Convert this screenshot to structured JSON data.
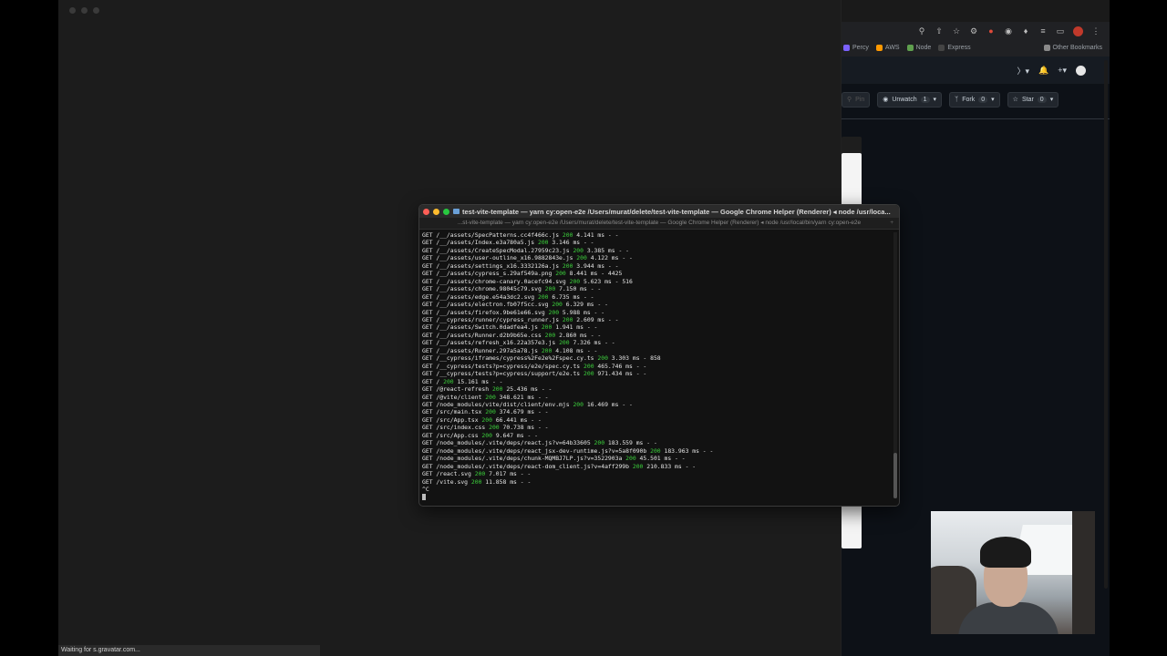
{
  "big_window": {
    "status_text": "Waiting for s.gravatar.com..."
  },
  "browser": {
    "bookmarks": [
      {
        "label": "Percy",
        "color": "#7b61ff"
      },
      {
        "label": "AWS",
        "color": "#ff9900"
      },
      {
        "label": "Node",
        "color": "#5fa04e"
      },
      {
        "label": "Express",
        "color": "#444444"
      }
    ],
    "other_bookmarks": "Other Bookmarks",
    "repo_actions": {
      "pin": "Pin",
      "unwatch": "Unwatch",
      "unwatch_count": "1",
      "fork": "Fork",
      "fork_count": "0",
      "star": "Star",
      "star_count": "0"
    }
  },
  "terminal": {
    "title": "test-vite-template — yarn cy:open-e2e /Users/murat/delete/test-vite-template — Google Chrome Helper (Renderer) ◂ node /usr/loca...",
    "tab_title": "...st-vite-template — yarn cy:open-e2e /Users/murat/delete/test-vite-template — Google Chrome Helper (Renderer) ◂ node /usr/local/bin/yarn cy:open-e2e",
    "lines": [
      {
        "pre": "GET /__/assets/SpecPatterns.cc4f466c.js ",
        "status": "200",
        "post": " 4.141 ms - -"
      },
      {
        "pre": "GET /__/assets/Index.e3a780a5.js ",
        "status": "200",
        "post": " 3.146 ms - -"
      },
      {
        "pre": "GET /__/assets/CreateSpecModal.27959c23.js ",
        "status": "200",
        "post": " 3.385 ms - -"
      },
      {
        "pre": "GET /__/assets/user-outline_x16.9882843e.js ",
        "status": "200",
        "post": " 4.122 ms - -"
      },
      {
        "pre": "GET /__/assets/settings_x16.3332126a.js ",
        "status": "200",
        "post": " 3.944 ms - -"
      },
      {
        "pre": "GET /__/assets/cypress_s.29af549a.png ",
        "status": "200",
        "post": " 8.441 ms - 4425"
      },
      {
        "pre": "GET /__/assets/chrome-canary.0acefc94.svg ",
        "status": "200",
        "post": " 5.623 ms - 516"
      },
      {
        "pre": "GET /__/assets/chrome.98045c79.svg ",
        "status": "200",
        "post": " 7.150 ms - -"
      },
      {
        "pre": "GET /__/assets/edge.e54a3dc2.svg ",
        "status": "200",
        "post": " 6.735 ms - -"
      },
      {
        "pre": "GET /__/assets/electron.fb07f5cc.svg ",
        "status": "200",
        "post": " 6.329 ms - -"
      },
      {
        "pre": "GET /__/assets/firefox.9be61e66.svg ",
        "status": "200",
        "post": " 5.988 ms - -"
      },
      {
        "pre": "GET /__cypress/runner/cypress_runner.js ",
        "status": "200",
        "post": " 2.609 ms - -"
      },
      {
        "pre": "GET /__/assets/Switch.0dadfea4.js ",
        "status": "200",
        "post": " 1.941 ms - -"
      },
      {
        "pre": "GET /__/assets/Runner.d2b9b65e.css ",
        "status": "200",
        "post": " 2.860 ms - -"
      },
      {
        "pre": "GET /__/assets/refresh_x16.22a357e3.js ",
        "status": "200",
        "post": " 7.326 ms - -"
      },
      {
        "pre": "GET /__/assets/Runner.297a5a78.js ",
        "status": "200",
        "post": " 4.108 ms - -"
      },
      {
        "pre": "GET /__cypress/iframes/cypress%2Fe2e%2Fspec.cy.ts ",
        "status": "200",
        "post": " 3.303 ms - 858"
      },
      {
        "pre": "GET /__cypress/tests?p=cypress/e2e/spec.cy.ts ",
        "status": "200",
        "post": " 465.746 ms - -"
      },
      {
        "pre": "GET /__cypress/tests?p=cypress/support/e2e.ts ",
        "status": "200",
        "post": " 971.434 ms - -"
      },
      {
        "pre": "GET / ",
        "status": "200",
        "post": " 15.161 ms - -"
      },
      {
        "pre": "GET /@react-refresh ",
        "status": "200",
        "post": " 25.436 ms - -"
      },
      {
        "pre": "GET /@vite/client ",
        "status": "200",
        "post": " 348.621 ms - -"
      },
      {
        "pre": "GET /node_modules/vite/dist/client/env.mjs ",
        "status": "200",
        "post": " 16.469 ms - -"
      },
      {
        "pre": "GET /src/main.tsx ",
        "status": "200",
        "post": " 374.679 ms - -"
      },
      {
        "pre": "GET /src/App.tsx ",
        "status": "200",
        "post": " 66.441 ms - -"
      },
      {
        "pre": "GET /src/index.css ",
        "status": "200",
        "post": " 70.738 ms - -"
      },
      {
        "pre": "GET /src/App.css ",
        "status": "200",
        "post": " 9.647 ms - -"
      },
      {
        "pre": "GET /node_modules/.vite/deps/react.js?v=64b33605 ",
        "status": "200",
        "post": " 183.559 ms - -"
      },
      {
        "pre": "GET /node_modules/.vite/deps/react_jsx-dev-runtime.js?v=5a8f090b ",
        "status": "200",
        "post": " 183.963 ms - -"
      },
      {
        "pre": "GET /node_modules/.vite/deps/chunk-MQMBJ7LP.js?v=3522903a ",
        "status": "200",
        "post": " 45.501 ms - -"
      },
      {
        "pre": "GET /node_modules/.vite/deps/react-dom_client.js?v=4aff299b ",
        "status": "200",
        "post": " 210.833 ms - -"
      },
      {
        "pre": "GET /react.svg ",
        "status": "200",
        "post": " 7.017 ms - -"
      },
      {
        "pre": "GET /vite.svg ",
        "status": "200",
        "post": " 11.858 ms - -"
      }
    ],
    "interrupt": "^C"
  }
}
